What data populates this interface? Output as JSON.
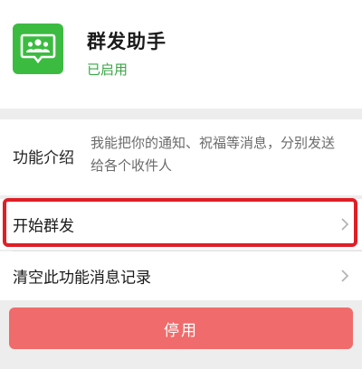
{
  "app": {
    "title": "群发助手",
    "status": "已启用",
    "icon": "group-chat-icon",
    "icon_color": "#3cbb41"
  },
  "intro": {
    "label": "功能介绍",
    "text": "我能把你的通知、祝福等消息，分别发送给各个收件人"
  },
  "rows": [
    {
      "label": "开始群发",
      "icon": "chevron-right-icon",
      "highlighted": true,
      "highlight_color": "#e01e26"
    },
    {
      "label": "清空此功能消息记录",
      "icon": "chevron-right-icon",
      "highlighted": false
    }
  ],
  "disable_button": {
    "label": "停用",
    "color": "#f06b6b"
  }
}
